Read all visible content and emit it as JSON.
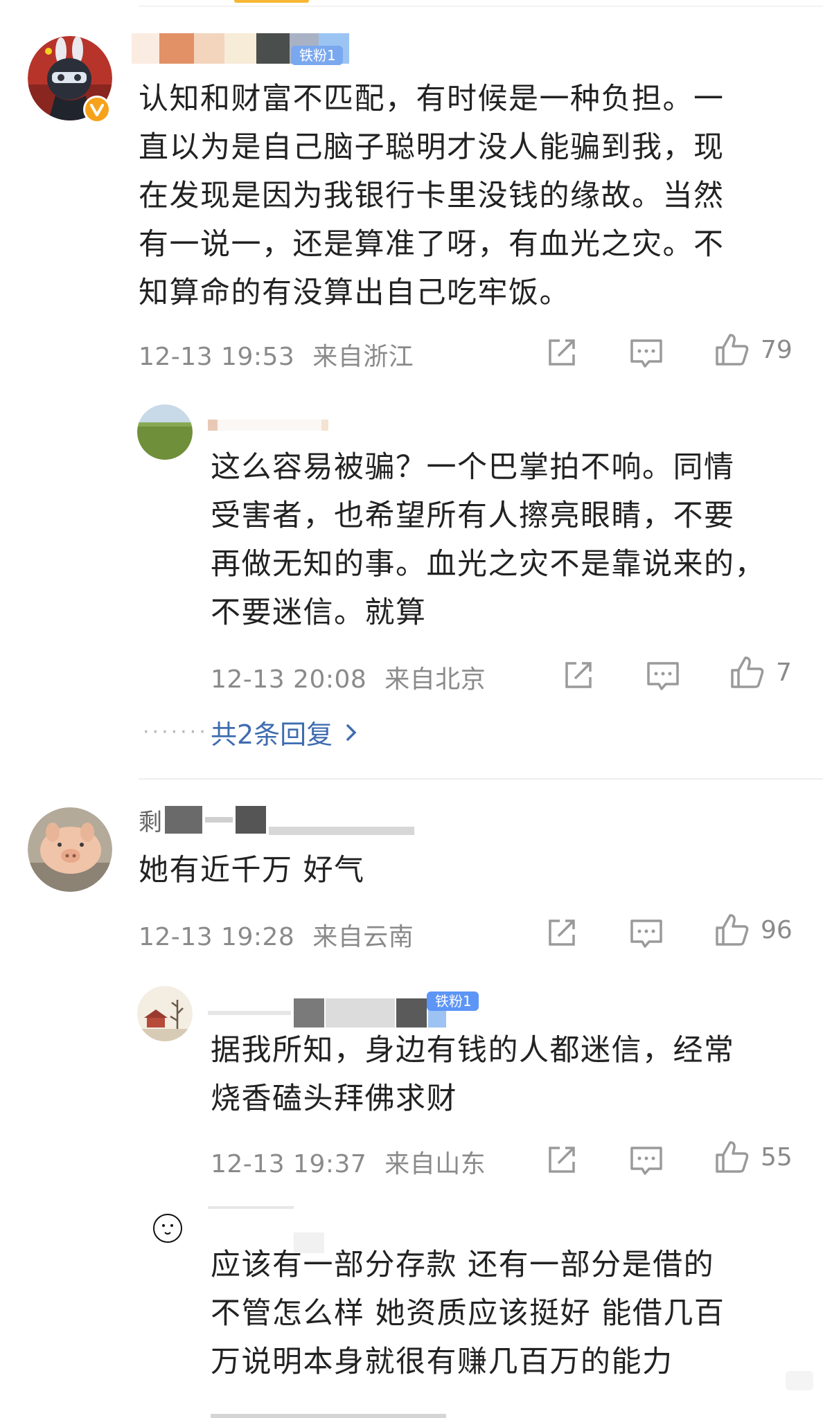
{
  "comments": [
    {
      "text_lines": [
        "认知和财富不匹配，有时候是一种负担。一",
        "直以为是自己脑子聪明才没人能骗到我，现",
        "在发现是因为我银行卡里没钱的缘故。当然",
        "有一说一，还是算准了呀，有血光之灾。不",
        "知算命的有没算出自己吃牢饭。"
      ],
      "timestamp": "12-13 19:53",
      "location": "来自浙江",
      "likes": "79",
      "badge": "铁粉1",
      "replies": [
        {
          "text_lines": [
            "这么容易被骗？一个巴掌拍不响。同情",
            "受害者，也希望所有人擦亮眼睛，不要",
            "再做无知的事。血光之灾不是靠说来的，",
            "不要迷信。就算"
          ],
          "timestamp": "12-13 20:08",
          "location": "来自北京",
          "likes": "7"
        }
      ],
      "more_replies": "共2条回复"
    },
    {
      "name_fragment": "剩",
      "text_lines": [
        "她有近千万 好气"
      ],
      "timestamp": "12-13 19:28",
      "location": "来自云南",
      "likes": "96",
      "replies": [
        {
          "badge": "铁粉1",
          "text_lines": [
            "据我所知，身边有钱的人都迷信，经常",
            "烧香磕头拜佛求财"
          ],
          "timestamp": "12-13 19:37",
          "location": "来自山东",
          "likes": "55"
        },
        {
          "text_lines": [
            "应该有一部分存款 还有一部分是借的",
            "不管怎么样 她资质应该挺好 能借几百",
            "万说明本身就很有赚几百万的能力"
          ]
        }
      ]
    }
  ],
  "icons": {
    "share": "share-icon",
    "comment": "comment-icon",
    "like": "thumbs-up-icon",
    "verified": "verified-v-icon",
    "chevron": "chevron-right-icon"
  },
  "colors": {
    "link": "#3f6cb0",
    "meta": "#8a8a8a",
    "badge": "#5c95f5",
    "verified": "#f7a21b"
  }
}
